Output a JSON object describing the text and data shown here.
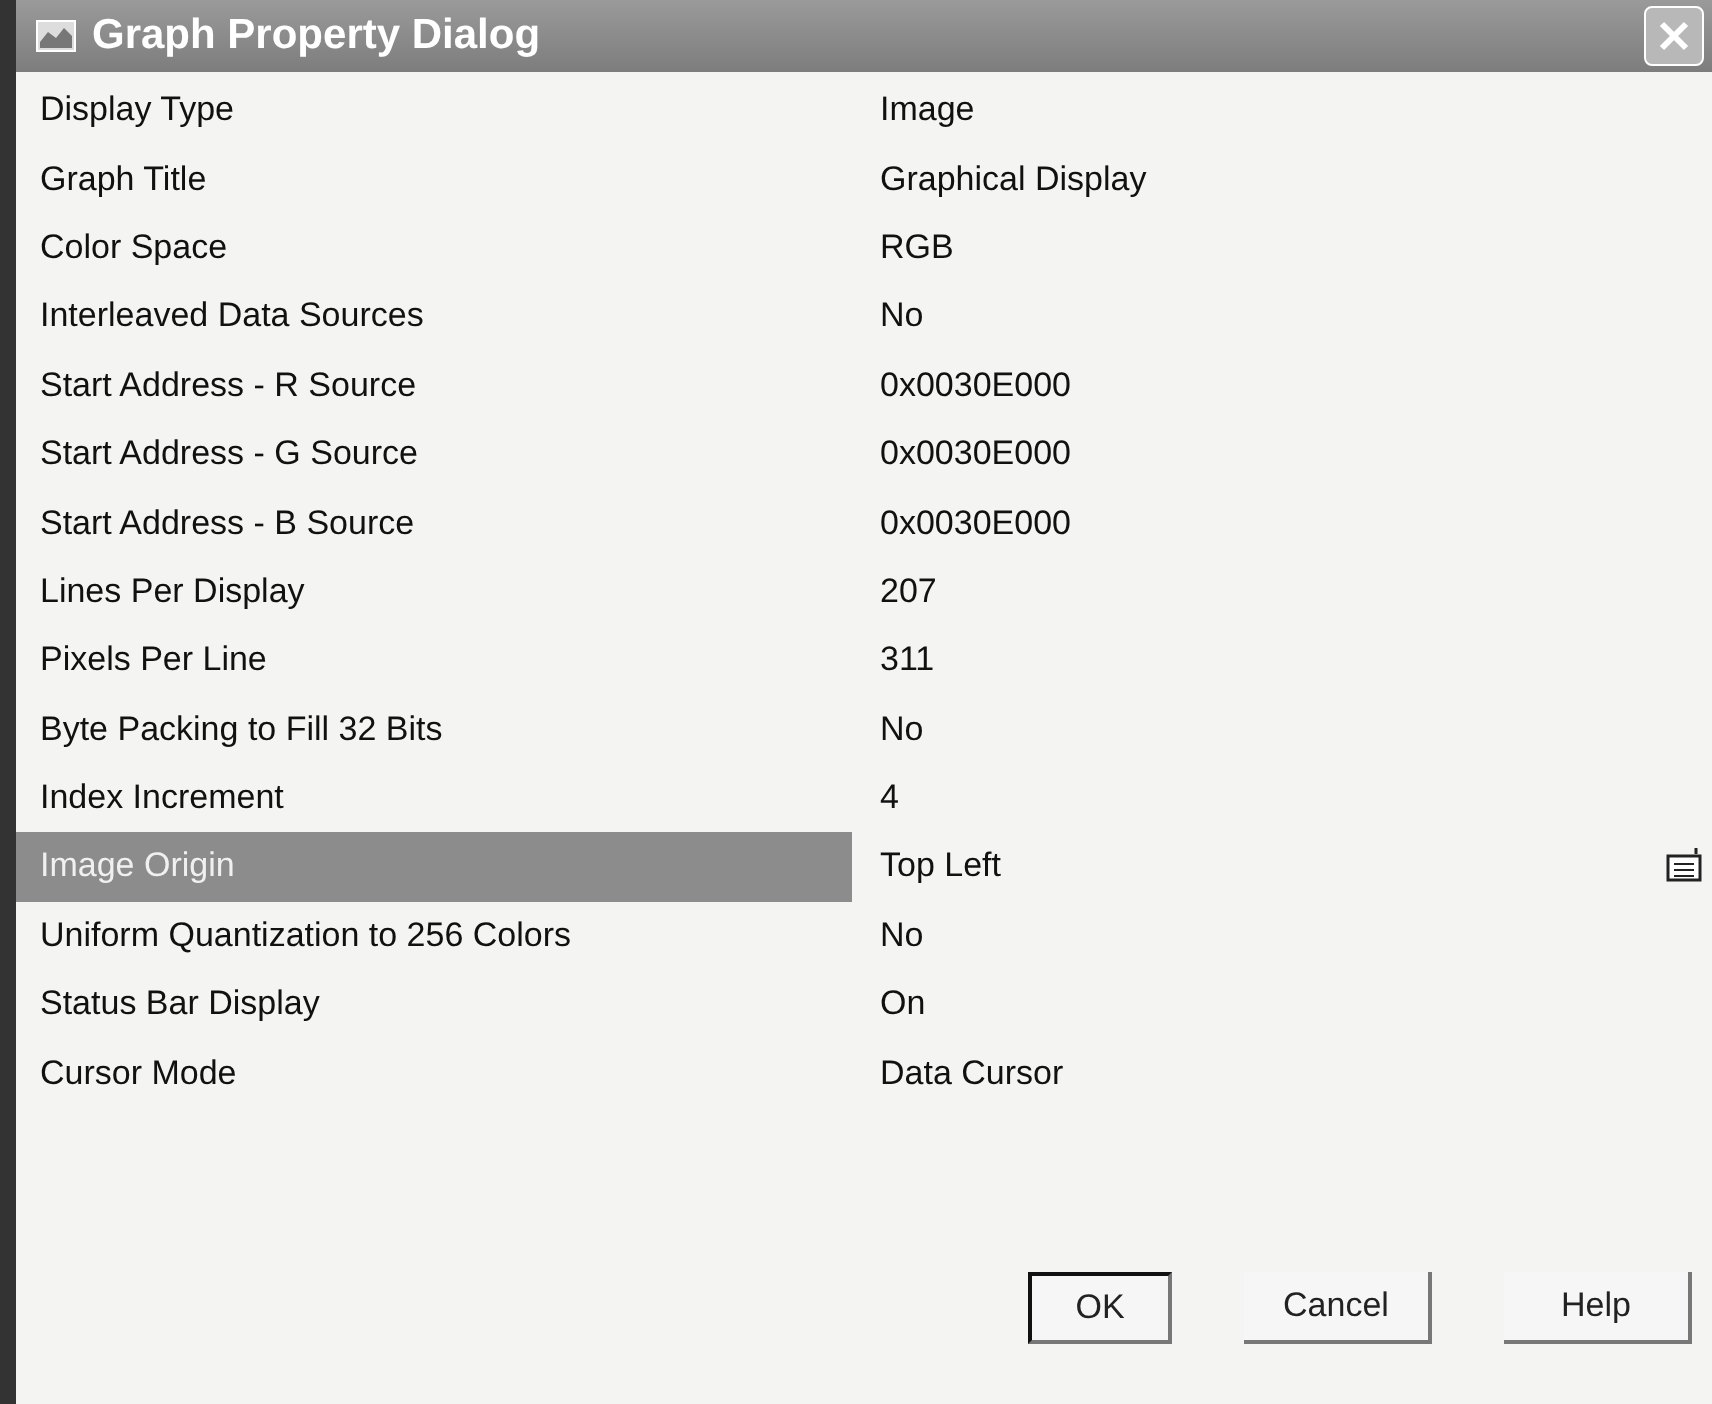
{
  "window": {
    "title": "Graph Property Dialog"
  },
  "properties": [
    {
      "name": "Display Type",
      "value": "Image",
      "selected": false
    },
    {
      "name": "Graph Title",
      "value": "Graphical Display",
      "selected": false
    },
    {
      "name": "Color Space",
      "value": "RGB",
      "selected": false
    },
    {
      "name": "Interleaved Data Sources",
      "value": "No",
      "selected": false
    },
    {
      "name": "Start Address - R Source",
      "value": "0x0030E000",
      "selected": false
    },
    {
      "name": "Start Address - G Source",
      "value": "0x0030E000",
      "selected": false
    },
    {
      "name": "Start Address - B Source",
      "value": "0x0030E000",
      "selected": false
    },
    {
      "name": "Lines Per Display",
      "value": "207",
      "selected": false
    },
    {
      "name": "Pixels Per Line",
      "value": "311",
      "selected": false
    },
    {
      "name": "Byte Packing to Fill 32 Bits",
      "value": "No",
      "selected": false
    },
    {
      "name": "Index Increment",
      "value": "4",
      "selected": false
    },
    {
      "name": "Image Origin",
      "value": "Top Left",
      "selected": true
    },
    {
      "name": "Uniform Quantization to 256 Colors",
      "value": "No",
      "selected": false
    },
    {
      "name": "Status Bar Display",
      "value": "On",
      "selected": false
    },
    {
      "name": "Cursor Mode",
      "value": "Data Cursor",
      "selected": false
    }
  ],
  "buttons": [
    {
      "label": "OK",
      "default": true
    },
    {
      "label": "Cancel",
      "default": false
    },
    {
      "label": "Help",
      "default": false
    }
  ]
}
